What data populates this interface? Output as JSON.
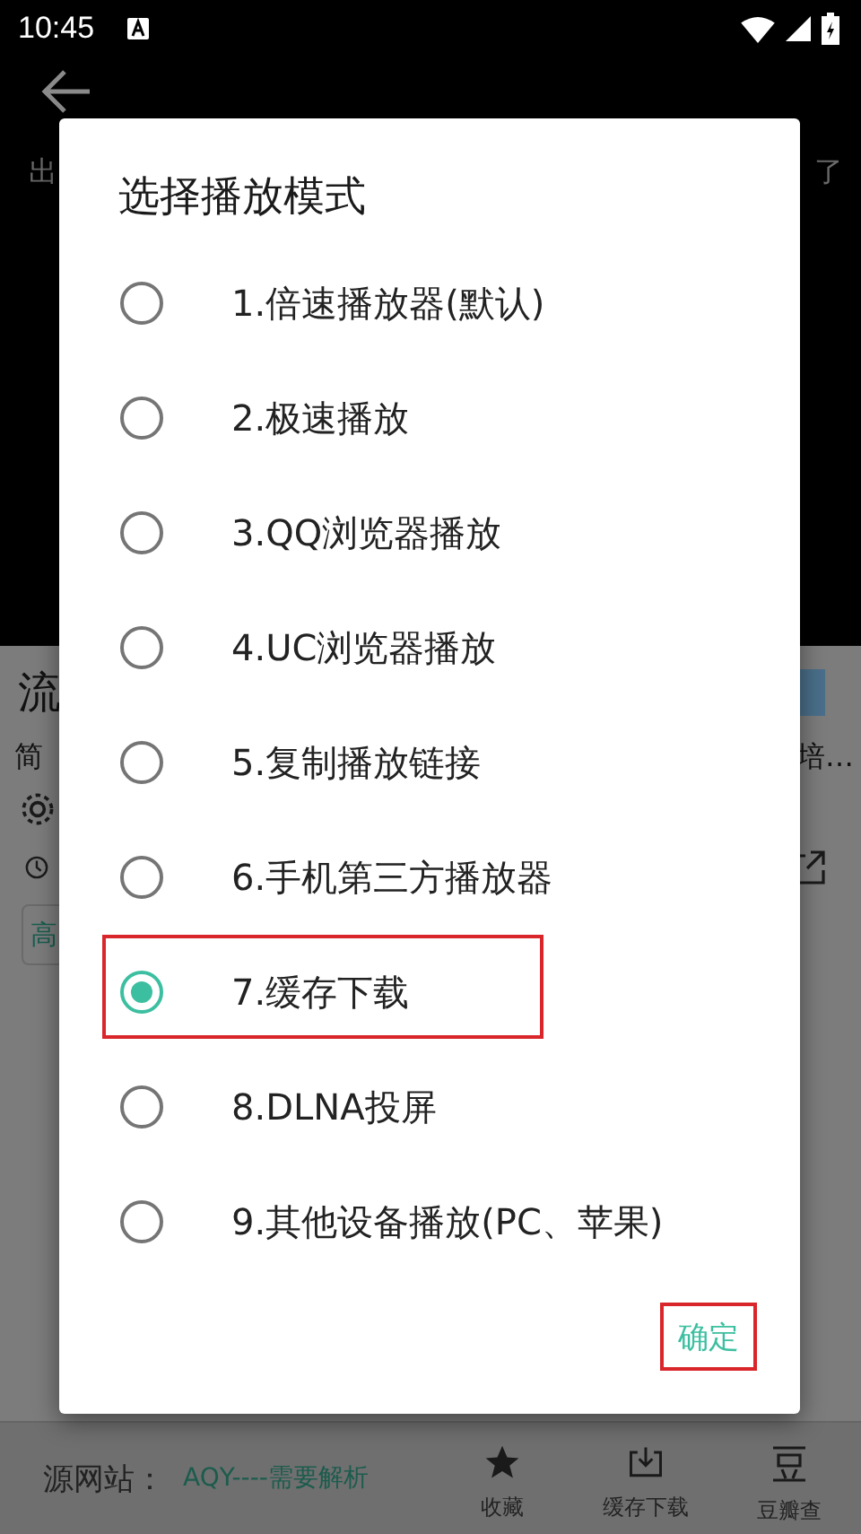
{
  "status_bar": {
    "time": "10:45"
  },
  "background": {
    "header_left": "出",
    "header_right": "了",
    "title": "流",
    "intro": "简",
    "intro_tail": "培…",
    "quality_chip": "高"
  },
  "source_bar": {
    "label": "源网站：",
    "value": "AQY----需要解析",
    "actions": [
      {
        "label": "收藏",
        "kind": "star"
      },
      {
        "label": "缓存下载",
        "kind": "download"
      },
      {
        "label": "豆瓣查",
        "kind": "douban"
      }
    ]
  },
  "dialog": {
    "title": "选择播放模式",
    "options": [
      {
        "label": "1.倍速播放器(默认)",
        "selected": false,
        "highlighted": false
      },
      {
        "label": "2.极速播放",
        "selected": false,
        "highlighted": false
      },
      {
        "label": "3.QQ浏览器播放",
        "selected": false,
        "highlighted": false
      },
      {
        "label": "4.UC浏览器播放",
        "selected": false,
        "highlighted": false
      },
      {
        "label": "5.复制播放链接",
        "selected": false,
        "highlighted": false
      },
      {
        "label": "6.手机第三方播放器",
        "selected": false,
        "highlighted": false
      },
      {
        "label": "7.缓存下载",
        "selected": true,
        "highlighted": true
      },
      {
        "label": "8.DLNA投屏",
        "selected": false,
        "highlighted": false
      },
      {
        "label": "9.其他设备播放(PC、苹果)",
        "selected": false,
        "highlighted": false
      }
    ],
    "confirm": {
      "label": "确定",
      "highlighted": true
    }
  }
}
